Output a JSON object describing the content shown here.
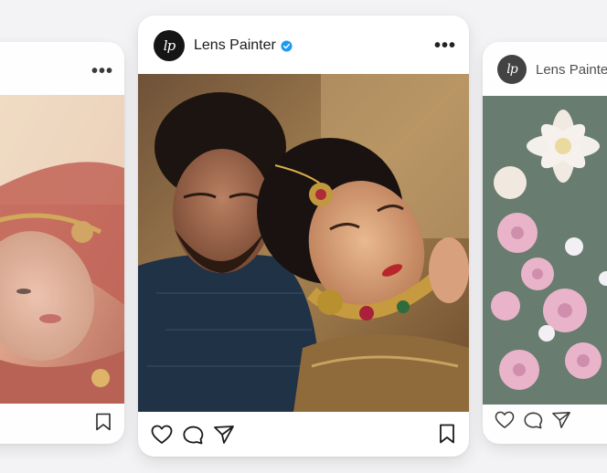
{
  "posts": [
    {
      "account_name": "",
      "avatar_text": "",
      "more_label": "•••",
      "photo": "bride-red-lehenga"
    },
    {
      "account_name": "Lens Painter",
      "avatar_text": "lp",
      "verified": true,
      "more_label": "•••",
      "photo": "couple-wedding-portrait"
    },
    {
      "account_name": "Lens Painter",
      "avatar_text": "lp",
      "more_label": "",
      "photo": "floral-bouquet"
    }
  ],
  "icons": [
    "heart-icon",
    "comment-icon",
    "share-icon",
    "bookmark-icon",
    "verified-badge-icon",
    "more-options-icon"
  ],
  "colors": {
    "background": "#f3f3f5",
    "card": "#ffffff",
    "verified": "#1d9bf0",
    "avatar": "#151515"
  }
}
